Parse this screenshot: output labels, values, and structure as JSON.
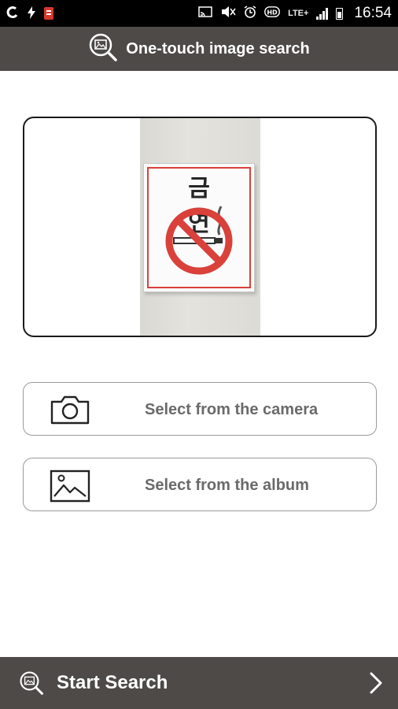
{
  "status_bar": {
    "time": "16:54",
    "network": "LTE+",
    "left_icons": [
      "notification-c-icon",
      "lightning-icon",
      "app-notification-icon"
    ],
    "right_icons": [
      "cast-icon",
      "mute-icon",
      "alarm-icon",
      "hd-icon",
      "lte-icon",
      "signal-icon",
      "battery-icon"
    ]
  },
  "header": {
    "title": "One-touch image search",
    "icon": "image-search-icon"
  },
  "preview": {
    "sign_text": "금 연",
    "sign_icon": "no-smoking-icon"
  },
  "options": {
    "camera": {
      "label": "Select from the camera",
      "icon": "camera-icon"
    },
    "album": {
      "label": "Select from the album",
      "icon": "image-icon"
    }
  },
  "bottom_bar": {
    "label": "Start Search",
    "icon": "image-search-icon",
    "chevron": "chevron-right-icon"
  },
  "colors": {
    "bar_background": "#4d4a47",
    "sign_red": "#d9413a",
    "option_text": "#6a6a6a"
  }
}
